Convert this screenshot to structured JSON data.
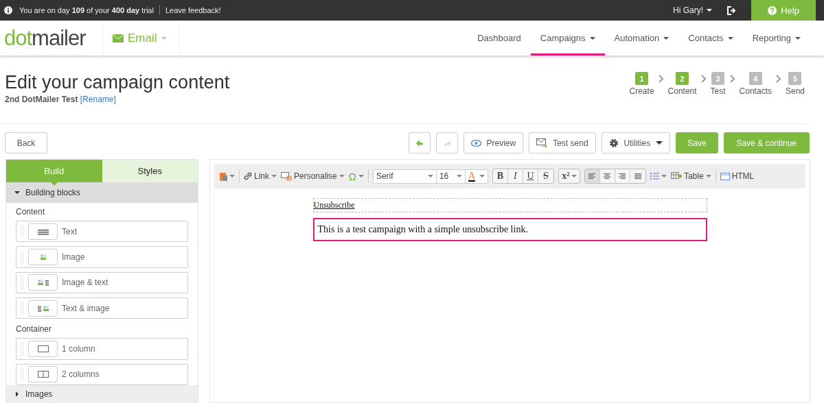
{
  "trial_bar": {
    "message": "You are on day **109** of your **400 day** trial",
    "feedback": "Leave feedback!",
    "greeting": "Hi Gary!",
    "help": "Help"
  },
  "header": {
    "logo_left": "dot",
    "logo_right": "mailer",
    "product": "Email",
    "nav": [
      {
        "label": "Dashboard",
        "selected": false,
        "dropdown": false
      },
      {
        "label": "Campaigns",
        "selected": true,
        "dropdown": true
      },
      {
        "label": "Automation",
        "selected": false,
        "dropdown": true
      },
      {
        "label": "Contacts",
        "selected": false,
        "dropdown": true
      },
      {
        "label": "Reporting",
        "selected": false,
        "dropdown": true
      }
    ]
  },
  "page": {
    "title": "Edit your campaign content",
    "campaign": "2nd DotMailer Test",
    "rename": "[Rename]"
  },
  "steps": [
    {
      "number": "1",
      "label": "Create",
      "completed": true
    },
    {
      "number": "2",
      "label": "Content",
      "completed": true
    },
    {
      "number": "3",
      "label": "Test",
      "completed": false
    },
    {
      "number": "4",
      "label": "Contacts",
      "completed": false
    },
    {
      "number": "5",
      "label": "Send",
      "completed": false
    }
  ],
  "actions": {
    "back": "Back",
    "undo_disabled": false,
    "redo_disabled": true,
    "preview": "Preview",
    "test_send": "Test send",
    "utilities": "Utilities",
    "save": "Save",
    "save_continue": "Save & continue"
  },
  "panel": {
    "tabs": [
      {
        "label": "Build",
        "selected": true
      },
      {
        "label": "Styles",
        "selected": false
      }
    ],
    "section": {
      "label": "Building blocks",
      "expanded": true
    },
    "groups": [
      {
        "title": "Content",
        "blocks": [
          {
            "label": "Text",
            "kind": "text"
          },
          {
            "label": "Image",
            "kind": "image"
          },
          {
            "label": "Image & text",
            "kind": "imagetext"
          },
          {
            "label": "Text & image",
            "kind": "textimage"
          }
        ]
      },
      {
        "title": "Container",
        "blocks": [
          {
            "label": "1 column",
            "kind": "col1"
          },
          {
            "label": "2 columns",
            "kind": "col2"
          }
        ]
      }
    ],
    "footer": {
      "label": "Images",
      "expanded": false
    }
  },
  "toolbar": {
    "link": "Link",
    "personalise": "Personalise",
    "omega": "Ω",
    "font": "Serif",
    "size": "16",
    "color_letter": "A",
    "styles": [
      "B",
      "I",
      "U",
      "S"
    ],
    "superscript": "x²",
    "align": [
      {
        "kind": "left",
        "selected": true
      },
      {
        "kind": "center",
        "selected": false
      },
      {
        "kind": "right",
        "selected": false
      },
      {
        "kind": "justify",
        "selected": false
      }
    ],
    "table": "Table",
    "html": "HTML"
  },
  "canvas": {
    "unsubscribe": "Unsubscribe",
    "body": "This is a test campaign with a simple unsubscribe link."
  }
}
